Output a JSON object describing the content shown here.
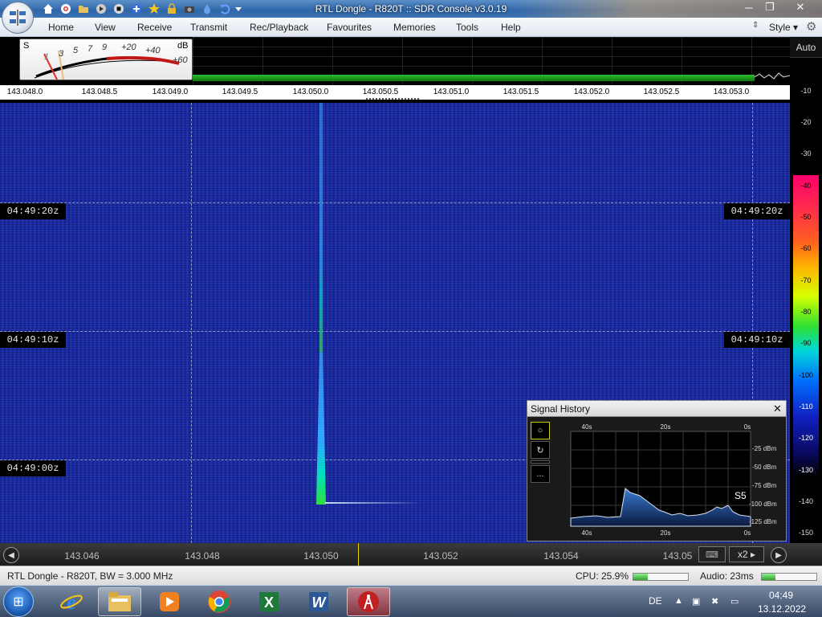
{
  "window": {
    "title": "RTL Dongle - R820T :: SDR Console v3.0.19",
    "controls": [
      "minimize",
      "restore",
      "close"
    ]
  },
  "quick_access": [
    "home-icon",
    "lifebuoy-icon",
    "folder-icon",
    "play-icon",
    "stop-icon",
    "add-icon",
    "star-icon",
    "lock-icon",
    "camera-icon",
    "drop-icon",
    "undo-icon",
    "customize-icon"
  ],
  "menu": {
    "items": [
      "Home",
      "View",
      "Receive",
      "Transmit",
      "Rec/Playback",
      "Favourites",
      "Memories",
      "Tools",
      "Help"
    ],
    "style_label": "Style"
  },
  "smeter": {
    "s_label": "S",
    "db_label": "dB",
    "s_marks": [
      "1",
      "3",
      "5",
      "7",
      "9"
    ],
    "db_marks": [
      "+20",
      "+40",
      "+60"
    ]
  },
  "spectrum": {
    "auto_label": "Auto",
    "freq_ticks": [
      "143.048.0",
      "143.048.5",
      "143.049.0",
      "143.049.5",
      "143.050.0",
      "143.050.5",
      "143.051.0",
      "143.051.5",
      "143.052.0",
      "143.052.5",
      "143.053.0"
    ]
  },
  "db_scale": [
    "-10",
    "-20",
    "-30",
    "-40",
    "-50",
    "-60",
    "-70",
    "-80",
    "-90",
    "-100",
    "-110",
    "-120",
    "-130",
    "-140",
    "-150"
  ],
  "waterfall": {
    "time_labels": [
      "04:49:20z",
      "04:49:10z",
      "04:49:00z"
    ]
  },
  "freq_bottom": {
    "ticks": [
      "143.046",
      "143.048",
      "143.050",
      "143.052",
      "143.054",
      "143.05"
    ],
    "zoom_label": "x2"
  },
  "signal_history": {
    "title": "Signal History",
    "x_labels": [
      "40s",
      "20s",
      "0s"
    ],
    "y_labels": [
      "-25 dBm",
      "-50 dBm",
      "-75 dBm",
      "-100 dBm",
      "-125 dBm"
    ],
    "s_reading": "S5",
    "side_buttons": [
      "○",
      "↻",
      "-",
      "..."
    ]
  },
  "status": {
    "device": "RTL Dongle - R820T, BW = 3.000 MHz",
    "cpu": "CPU: 25.9%",
    "cpu_level": 0.26,
    "audio": "Audio: 23ms",
    "audio_level": 0.25
  },
  "taskbar": {
    "apps": [
      "internet-explorer-icon",
      "file-explorer-icon",
      "media-player-icon",
      "chrome-icon",
      "excel-icon",
      "word-icon",
      "sdr-console-icon"
    ],
    "language": "DE",
    "time": "04:49",
    "date": "13.12.2022"
  }
}
